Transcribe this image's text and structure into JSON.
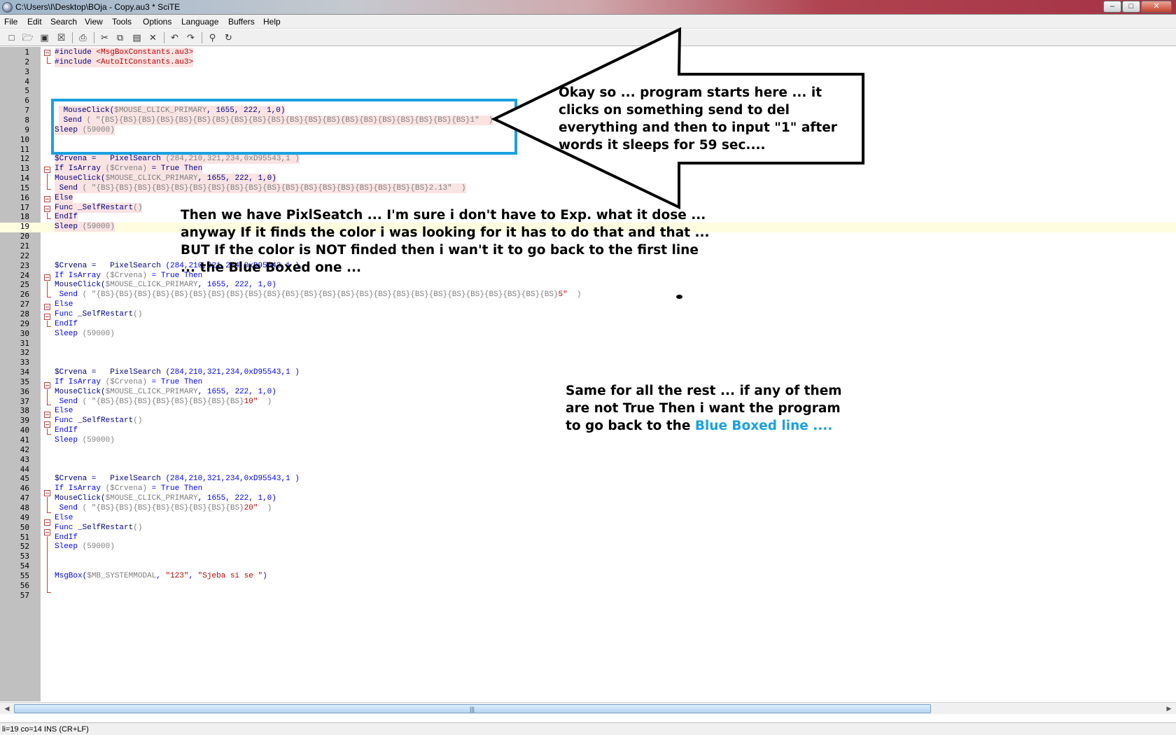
{
  "window": {
    "title": "C:\\Users\\I\\Desktop\\BOja - Copy.au3 * SciTE",
    "min_glyph": "–",
    "max_glyph": "□",
    "close_glyph": "✕"
  },
  "menu": [
    "File",
    "Edit",
    "Search",
    "View",
    "Tools",
    "Options",
    "Language",
    "Buffers",
    "Help"
  ],
  "toolbar": {
    "icons": [
      "new-file-icon",
      "open-folder-icon",
      "save-icon",
      "close-file-icon",
      "print-icon",
      "cut-icon",
      "copy-icon",
      "paste-icon",
      "delete-icon",
      "undo-icon",
      "redo-icon",
      "find-icon",
      "replace-icon"
    ]
  },
  "code": {
    "lines": [
      {
        "n": "1",
        "parts": [
          [
            "cm",
            "#include "
          ],
          [
            "rd",
            "<MsgBoxConstants.au3>"
          ]
        ]
      },
      {
        "n": "2",
        "parts": [
          [
            "cm",
            "#include "
          ],
          [
            "rd",
            "<AutoItConstants.au3>"
          ]
        ]
      },
      {
        "n": "3",
        "parts": []
      },
      {
        "n": "4",
        "parts": []
      },
      {
        "n": "5",
        "parts": []
      },
      {
        "n": "6",
        "parts": []
      },
      {
        "n": "7",
        "parts": [
          [
            "cm",
            " MouseClick("
          ],
          [
            "gr",
            "$MOUSE_CLICK_PRIMARY"
          ],
          [
            "cm",
            ", 1655, 222, 1,0)"
          ]
        ]
      },
      {
        "n": "8",
        "parts": [
          [
            "cm",
            " Send "
          ],
          [
            "gr",
            "( \"{BS}{BS}{BS}{BS}{BS}{BS}{BS}{BS}{BS}{BS}{BS}{BS}{BS}{BS}{BS}{BS}{BS}{BS}{BS}{BS}1\"  )"
          ]
        ]
      },
      {
        "n": "9",
        "parts": [
          [
            "cm",
            "Sleep "
          ],
          [
            "gr",
            "(59000)"
          ]
        ]
      },
      {
        "n": "10",
        "parts": []
      },
      {
        "n": "11",
        "parts": []
      },
      {
        "n": "12",
        "parts": [
          [
            "cm",
            "$Crvena =   PixelSearch "
          ],
          [
            "gr",
            "(284,210,321,234,0xD95543,1 )"
          ]
        ]
      },
      {
        "n": "13",
        "parts": [
          [
            "cm",
            "If IsArray "
          ],
          [
            "gr",
            "($Crvena)"
          ],
          [
            "cm",
            " = True Then"
          ]
        ]
      },
      {
        "n": "14",
        "parts": [
          [
            "cm",
            "MouseClick("
          ],
          [
            "gr",
            "$MOUSE_CLICK_PRIMARY"
          ],
          [
            "cm",
            ", 1655, 222, 1,0)"
          ]
        ]
      },
      {
        "n": "15",
        "parts": [
          [
            "cm",
            " Send "
          ],
          [
            "gr",
            "( \"{BS}{BS}{BS}{BS}{BS}{BS}{BS}{BS}{BS}{BS}{BS}{BS}{BS}{BS}{BS}{BS}{BS}{BS}2.13\"  )"
          ]
        ]
      },
      {
        "n": "16",
        "parts": [
          [
            "cm",
            "Else"
          ]
        ]
      },
      {
        "n": "17",
        "parts": [
          [
            "cm",
            "Func _SelfRestart"
          ],
          [
            "gr",
            "()"
          ]
        ]
      },
      {
        "n": "18",
        "parts": [
          [
            "cm",
            "EndIf"
          ]
        ]
      },
      {
        "n": "19",
        "parts": [
          [
            "cm",
            "Sleep "
          ],
          [
            "gr",
            "(59000)"
          ]
        ]
      },
      {
        "n": "20",
        "parts": []
      },
      {
        "n": "21",
        "parts": []
      },
      {
        "n": "22",
        "parts": []
      },
      {
        "n": "23",
        "parts": [
          [
            "cm",
            "$Crvena =   PixelSearch "
          ],
          [
            "kw",
            "(284,210,321,234,0xD95543,1 )"
          ]
        ]
      },
      {
        "n": "24",
        "parts": [
          [
            "kw",
            "If IsArray "
          ],
          [
            "gr",
            "($Crvena)"
          ],
          [
            "kw",
            " = True Then"
          ]
        ]
      },
      {
        "n": "25",
        "parts": [
          [
            "cm",
            "MouseClick("
          ],
          [
            "gr",
            "$MOUSE_CLICK_PRIMARY"
          ],
          [
            "kw",
            ", 1655, 222, 1,0)"
          ]
        ]
      },
      {
        "n": "26",
        "parts": [
          [
            "kw",
            " Send "
          ],
          [
            "gr",
            "( \"{BS}{BS}{BS}{BS}{BS}{BS}{BS}{BS}{BS}{BS}{BS}{BS}{BS}{BS}{BS}{BS}{BS}{BS}{BS}{BS}{BS}{BS}{BS}{BS}{BS}"
          ],
          [
            "rd",
            "5\""
          ],
          [
            "gr",
            "  )"
          ]
        ]
      },
      {
        "n": "27",
        "parts": [
          [
            "kw",
            "Else"
          ]
        ]
      },
      {
        "n": "28",
        "parts": [
          [
            "kw",
            "Func "
          ],
          [
            "cm",
            "_SelfRestart"
          ],
          [
            "gr",
            "()"
          ]
        ]
      },
      {
        "n": "29",
        "parts": [
          [
            "kw",
            "EndIf"
          ]
        ]
      },
      {
        "n": "30",
        "parts": [
          [
            "kw",
            "Sleep "
          ],
          [
            "gr",
            "(59000)"
          ]
        ]
      },
      {
        "n": "31",
        "parts": []
      },
      {
        "n": "32",
        "parts": []
      },
      {
        "n": "33",
        "parts": []
      },
      {
        "n": "34",
        "parts": [
          [
            "cm",
            "$Crvena =   PixelSearch "
          ],
          [
            "kw",
            "(284,210,321,234,0xD95543,1 )"
          ]
        ]
      },
      {
        "n": "35",
        "parts": [
          [
            "kw",
            "If IsArray "
          ],
          [
            "gr",
            "($Crvena)"
          ],
          [
            "kw",
            " = True Then"
          ]
        ]
      },
      {
        "n": "36",
        "parts": [
          [
            "cm",
            "MouseClick("
          ],
          [
            "gr",
            "$MOUSE_CLICK_PRIMARY"
          ],
          [
            "kw",
            ", 1655, 222, 1,0)"
          ]
        ]
      },
      {
        "n": "37",
        "parts": [
          [
            "kw",
            " Send "
          ],
          [
            "gr",
            "( \"{BS}{BS}{BS}{BS}{BS}{BS}{BS}{BS}"
          ],
          [
            "rd",
            "10\""
          ],
          [
            "gr",
            "  )"
          ]
        ]
      },
      {
        "n": "38",
        "parts": [
          [
            "kw",
            "Else"
          ]
        ]
      },
      {
        "n": "39",
        "parts": [
          [
            "kw",
            "Func "
          ],
          [
            "cm",
            "_SelfRestart"
          ],
          [
            "gr",
            "()"
          ]
        ]
      },
      {
        "n": "40",
        "parts": [
          [
            "kw",
            "EndIf"
          ]
        ]
      },
      {
        "n": "41",
        "parts": [
          [
            "kw",
            "Sleep "
          ],
          [
            "gr",
            "(59000)"
          ]
        ]
      },
      {
        "n": "42",
        "parts": []
      },
      {
        "n": "43",
        "parts": []
      },
      {
        "n": "44",
        "parts": []
      },
      {
        "n": "45",
        "parts": [
          [
            "cm",
            "$Crvena =   PixelSearch "
          ],
          [
            "kw",
            "(284,210,321,234,0xD95543,1 )"
          ]
        ]
      },
      {
        "n": "46",
        "parts": [
          [
            "kw",
            "If IsArray "
          ],
          [
            "gr",
            "($Crvena)"
          ],
          [
            "kw",
            " = True Then"
          ]
        ]
      },
      {
        "n": "47",
        "parts": [
          [
            "cm",
            "MouseClick("
          ],
          [
            "gr",
            "$MOUSE_CLICK_PRIMARY"
          ],
          [
            "kw",
            ", 1655, 222, 1,0)"
          ]
        ]
      },
      {
        "n": "48",
        "parts": [
          [
            "kw",
            " Send "
          ],
          [
            "gr",
            "( \"{BS}{BS}{BS}{BS}{BS}{BS}{BS}{BS}"
          ],
          [
            "rd",
            "20\""
          ],
          [
            "gr",
            "  )"
          ]
        ]
      },
      {
        "n": "49",
        "parts": [
          [
            "kw",
            "Else"
          ]
        ]
      },
      {
        "n": "50",
        "parts": [
          [
            "kw",
            "Func "
          ],
          [
            "cm",
            "_SelfRestart"
          ],
          [
            "gr",
            "()"
          ]
        ]
      },
      {
        "n": "51",
        "parts": [
          [
            "kw",
            "EndIf"
          ]
        ]
      },
      {
        "n": "52",
        "parts": [
          [
            "kw",
            "Sleep "
          ],
          [
            "gr",
            "(59000)"
          ]
        ]
      },
      {
        "n": "53",
        "parts": []
      },
      {
        "n": "54",
        "parts": []
      },
      {
        "n": "55",
        "parts": [
          [
            "kw",
            "MsgBox("
          ],
          [
            "gr",
            "$MB_SYSTEMMODAL"
          ],
          [
            "kw",
            ", "
          ],
          [
            "rd",
            "\"123\""
          ],
          [
            "kw",
            ", "
          ],
          [
            "rd",
            "\"Sjeba si se \""
          ],
          [
            "kw",
            ")"
          ]
        ]
      },
      {
        "n": "56",
        "parts": []
      },
      {
        "n": "57",
        "parts": []
      }
    ]
  },
  "annotations": {
    "note1": "Okay so ... program starts here ... it clicks on something send to del everything and then to input \"1\" after words it sleeps for 59 sec....",
    "note2": "Then we have PixlSeatch ... I'm sure i don't have to Exp. what it dose ... anyway If it finds the color i was looking for it has to do that and that ... BUT If the color is NOT finded then i wan't it to go back to the first line ... the Blue Boxed one ...",
    "note3_plain": "Same for all the rest ... if any of them are not True Then i want the program to go back to the ",
    "note3_blue": "Blue Boxed line ....",
    "blue_color": "#1aa1e0"
  },
  "statusbar": {
    "text": "li=19 co=14 INS (CR+LF)"
  },
  "scrollbar": {
    "left_arrow": "◀",
    "right_arrow": "▶",
    "grip": "|||"
  }
}
